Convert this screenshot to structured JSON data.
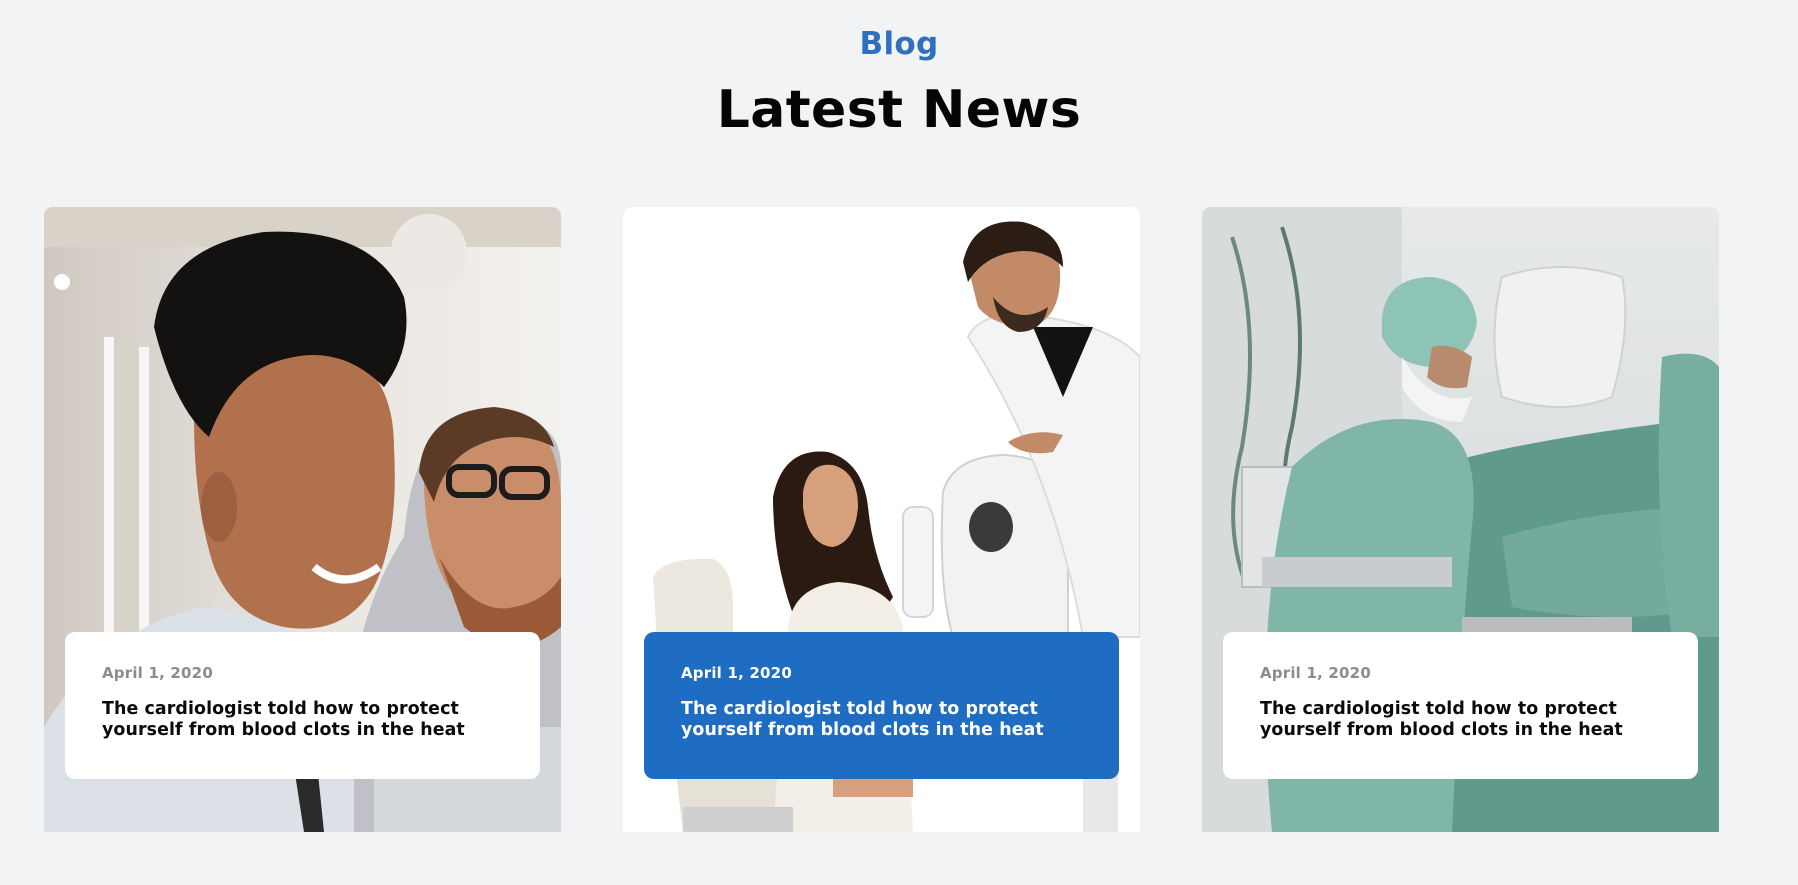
{
  "section": {
    "eyebrow": "Blog",
    "title": "Latest News"
  },
  "posts": [
    {
      "image": "two-smiling-men-photo",
      "date": "April 1, 2020",
      "title": "The cardiologist told how to protect yourself from blood clots in the heat",
      "active": false
    },
    {
      "image": "doctor-with-patient-eye-device-photo",
      "date": "April 1, 2020",
      "title": "The cardiologist told how to protect yourself from blood clots in the heat",
      "active": true
    },
    {
      "image": "surgeons-in-operating-room-photo",
      "date": "April 1, 2020",
      "title": "The cardiologist told how to protect yourself from blood clots in the heat",
      "active": false
    }
  ],
  "colors": {
    "background": "#f2f3f5",
    "accent": "#1f6cc3",
    "eyebrow": "#2f6fbf",
    "heading": "#050505",
    "date_muted": "#8c8c8c"
  }
}
